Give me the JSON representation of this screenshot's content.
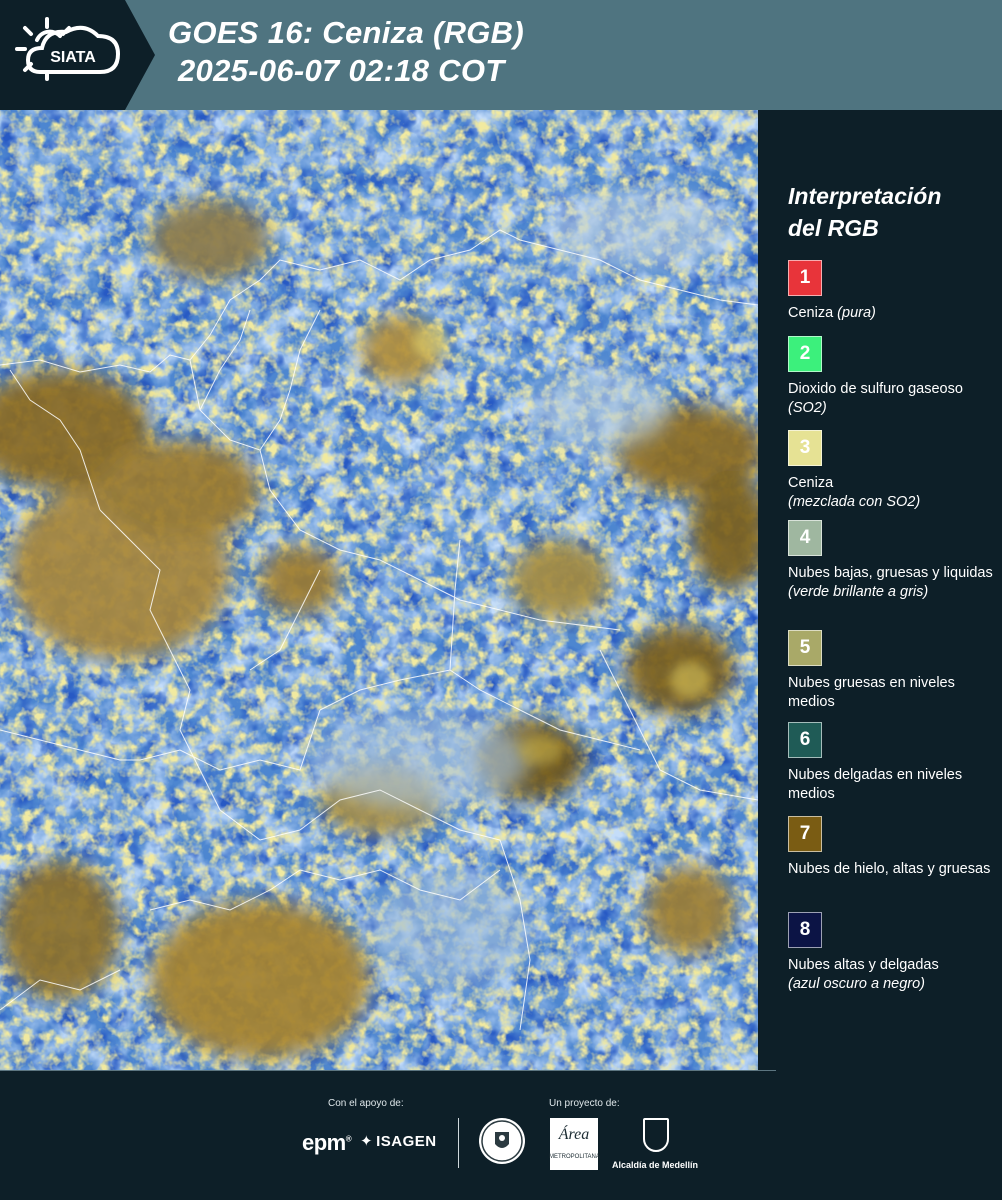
{
  "header": {
    "logo_text": "SIATA",
    "title_line1": "GOES 16: Ceniza (RGB)",
    "title_line2": "2025-06-07 02:18 COT",
    "background_color": "#4f7480"
  },
  "legend": {
    "title_line1": "Interpretación",
    "title_line2": "del RGB",
    "items": [
      {
        "number": "1",
        "color": "#e8343a",
        "label": "Ceniza",
        "note": "(pura)"
      },
      {
        "number": "2",
        "color": "#3cf07c",
        "label": "Dioxido de sulfuro gaseoso",
        "note": "(SO2)"
      },
      {
        "number": "3",
        "color": "#e6e294",
        "label": "Ceniza",
        "note": "(mezclada con SO2)"
      },
      {
        "number": "4",
        "color": "#9fb7a0",
        "label": "Nubes bajas, gruesas y liquidas",
        "note": "(verde brillante a gris)"
      },
      {
        "number": "5",
        "color": "#a9a968",
        "label": "Nubes gruesas en niveles medios",
        "note": ""
      },
      {
        "number": "6",
        "color": "#1f5b56",
        "label": "Nubes delgadas en niveles medios",
        "note": ""
      },
      {
        "number": "7",
        "color": "#7a5c13",
        "label": "Nubes de hielo, altas y gruesas",
        "note": ""
      },
      {
        "number": "8",
        "color": "#0c1445",
        "label": "Nubes altas y delgadas",
        "note": "(azul oscuro a negro)"
      }
    ]
  },
  "footer": {
    "support_label": "Con el apoyo de:",
    "project_label": "Un proyecto de:",
    "sponsor1": "epm",
    "sponsor2": "ISAGEN",
    "partner_area_mark": "Área",
    "partner_area_sub": "METROPOLITANA",
    "partner_alcaldia": "Alcaldía de Medellín"
  }
}
